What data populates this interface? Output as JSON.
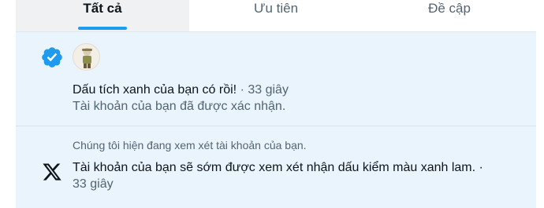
{
  "tabs": [
    {
      "label": "Tất cả",
      "active": true
    },
    {
      "label": "Ưu tiên",
      "active": false
    },
    {
      "label": "Đề cập",
      "active": false
    }
  ],
  "notifications": [
    {
      "icon": "verified-badge-icon",
      "title": "Dấu tích xanh của bạn có rồi!",
      "time": "· 33 giây",
      "body": "Tài khoản của bạn đã được xác nhận."
    },
    {
      "icon": "x-logo-icon",
      "header": "Chúng tôi hiện đang xem xét tài khoản của bạn.",
      "body": "Tài khoản của bạn sẽ sớm được xem xét nhận dấu kiểm màu xanh lam. ·",
      "time": "33 giây"
    }
  ],
  "colors": {
    "accent": "#1d9bf0",
    "notification_bg": "#e9f4fd",
    "muted_text": "#536471"
  }
}
